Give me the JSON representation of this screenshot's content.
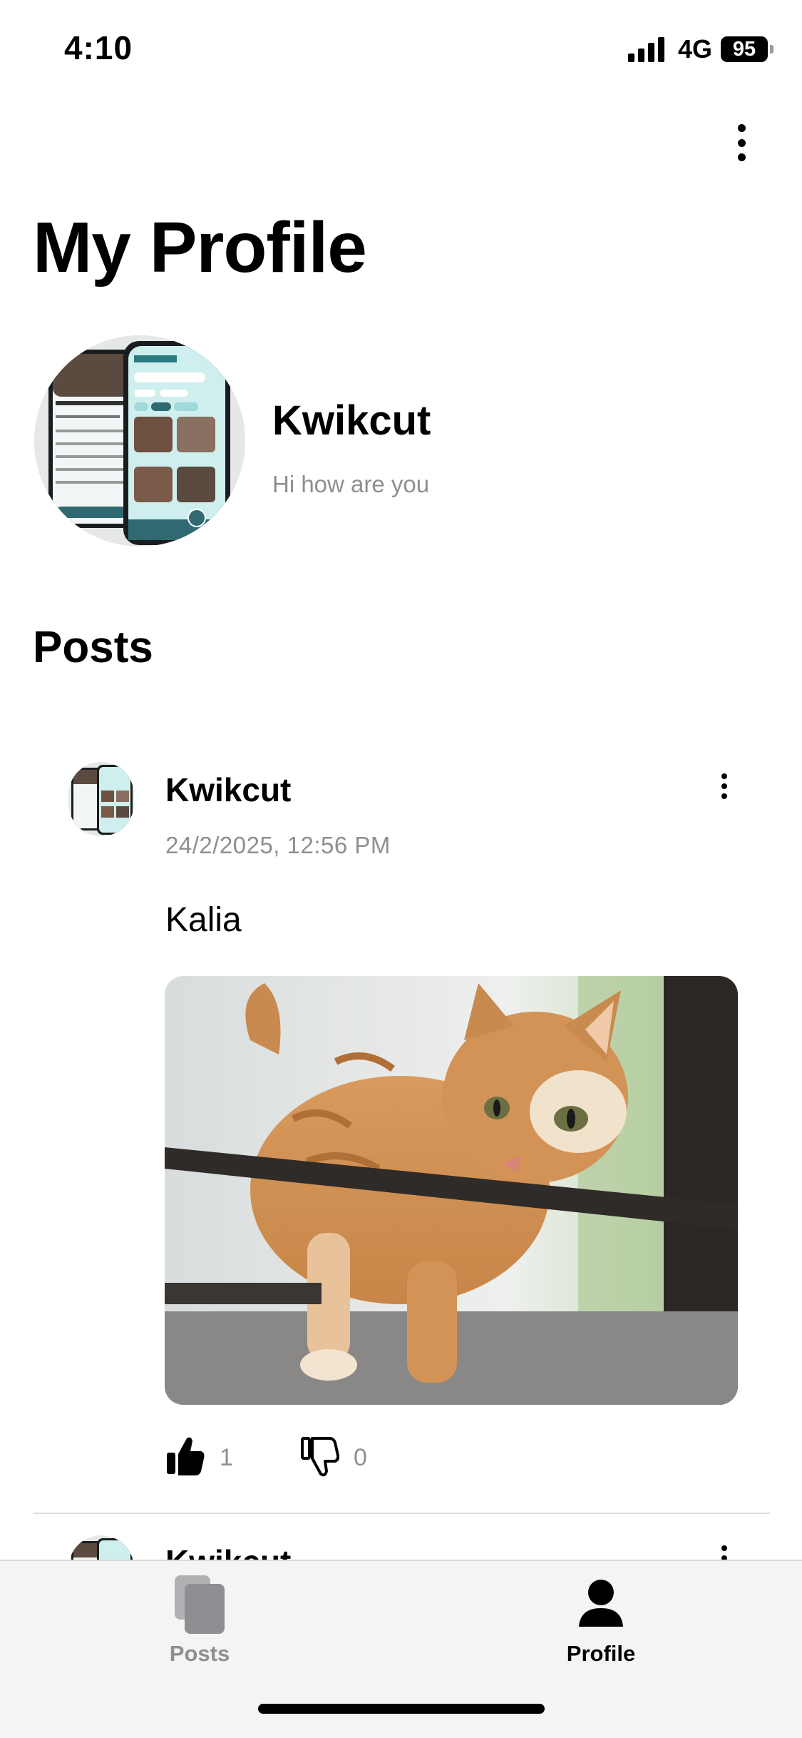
{
  "status_bar": {
    "time": "4:10",
    "network": "4G",
    "battery": "95"
  },
  "header": {
    "title": "My Profile",
    "menu_icon": "more-vertical-icon"
  },
  "profile": {
    "name": "Kwikcut",
    "bio": "Hi how are you"
  },
  "posts_section": {
    "heading": "Posts"
  },
  "posts": [
    {
      "author": "Kwikcut",
      "timestamp": "24/2/2025, 12:56 PM",
      "text": "Kalia",
      "likes": "1",
      "dislikes": "0"
    },
    {
      "author": "Kwikcut"
    }
  ],
  "tab_bar": {
    "tabs": [
      {
        "label": "Posts",
        "icon": "posts-icon",
        "active": false
      },
      {
        "label": "Profile",
        "icon": "person-icon",
        "active": true
      }
    ]
  },
  "colors": {
    "secondary_text": "#8e8e93",
    "active_tab": "#000000",
    "inactive_tab": "#8e8e93",
    "tab_bar_bg": "#f4f4f4"
  }
}
